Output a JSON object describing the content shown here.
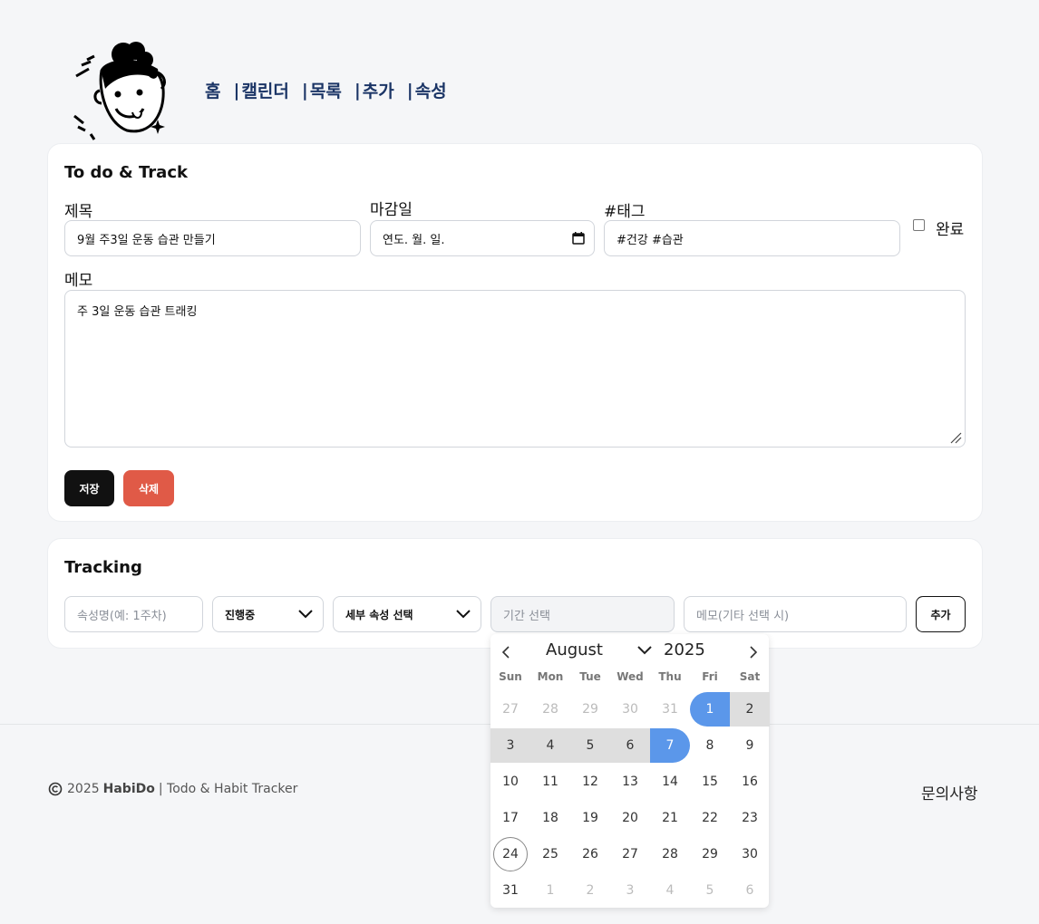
{
  "nav": {
    "home": "홈",
    "calendar": "캘린더",
    "list": "목록",
    "add": "추가",
    "property": "속성",
    "separator": "|"
  },
  "todo": {
    "title": "To do & Track",
    "subject_label": "제목",
    "subject_value": "9월 주3일 운동 습관 만들기",
    "due_label": "마감일",
    "due_placeholder": "연도. 월. 일.",
    "tag_label": "#태그",
    "tag_value": "#건강 #습관",
    "done_label": "완료",
    "done_checked": false,
    "memo_label": "메모",
    "memo_value": "주 3일 운동 습관 트래킹",
    "save_label": "저장",
    "delete_label": "삭제",
    "save_color": "#111111",
    "delete_color": "#e05a47"
  },
  "tracking": {
    "title": "Tracking",
    "name_placeholder": "속성명(예: 1주차)",
    "status_value": "진행중",
    "detail_value": "세부 속성 선택",
    "period_placeholder": "기간 선택",
    "memo_placeholder": "메모(기타 선택 시)",
    "add_label": "추가"
  },
  "datepicker": {
    "month": "August",
    "year": "2025",
    "weekdays": [
      "Sun",
      "Mon",
      "Tue",
      "Wed",
      "Thu",
      "Fri",
      "Sat"
    ],
    "weeks": [
      [
        "27",
        "28",
        "29",
        "30",
        "31",
        "1",
        "2"
      ],
      [
        "3",
        "4",
        "5",
        "6",
        "7",
        "8",
        "9"
      ],
      [
        "10",
        "11",
        "12",
        "13",
        "14",
        "15",
        "16"
      ],
      [
        "17",
        "18",
        "19",
        "20",
        "21",
        "22",
        "23"
      ],
      [
        "24",
        "25",
        "26",
        "27",
        "28",
        "29",
        "30"
      ],
      [
        "31",
        "1",
        "2",
        "3",
        "4",
        "5",
        "6"
      ]
    ],
    "range_start": "2025-08-01",
    "range_end": "2025-08-07",
    "today": "2025-08-24",
    "accent_color": "#5b97ea"
  },
  "footer": {
    "year": "2025",
    "brand": "HabiDo",
    "tagline": "| Todo & Habit Tracker",
    "contact": "문의사항"
  }
}
